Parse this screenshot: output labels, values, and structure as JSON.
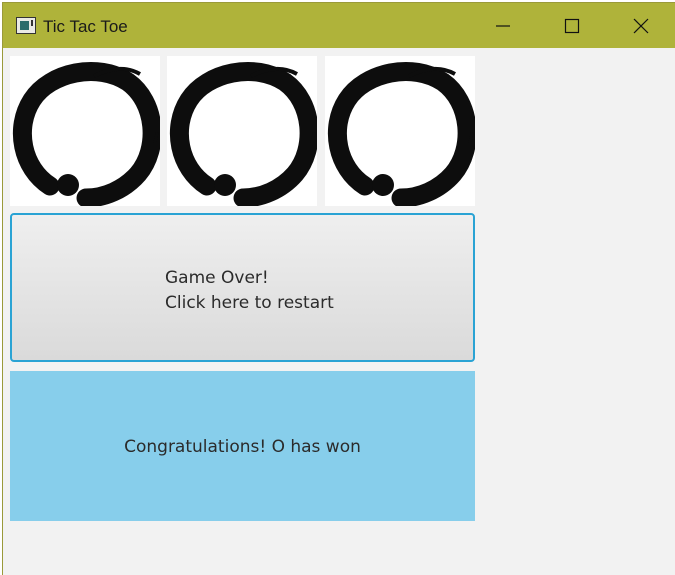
{
  "window": {
    "title": "Tic Tac Toe",
    "titlebar_color": "#afb33a",
    "controls": [
      "minimize-icon",
      "maximize-icon",
      "close-icon"
    ]
  },
  "board": {
    "cells": [
      "O",
      "O",
      "O"
    ],
    "cell_icon": "enso-circle-icon"
  },
  "restart_button": {
    "line1": "Game Over!",
    "line2": "Click here to restart",
    "border_color": "#2aa3d4"
  },
  "status": {
    "text": "Congratulations! O has won",
    "background": "#87ceeb"
  }
}
